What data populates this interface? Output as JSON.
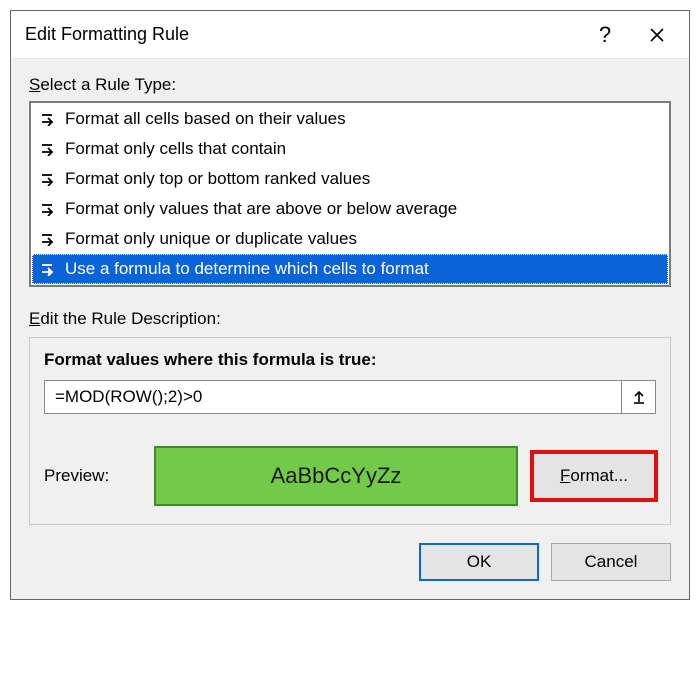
{
  "title": "Edit Formatting Rule",
  "sections": {
    "ruleType": {
      "label_pre": "S",
      "label_post": "elect a Rule Type:",
      "items": [
        "Format all cells based on their values",
        "Format only cells that contain",
        "Format only top or bottom ranked values",
        "Format only values that are above or below average",
        "Format only unique or duplicate values",
        "Use a formula to determine which cells to format"
      ],
      "selected_index": 5
    },
    "description": {
      "label_pre": "E",
      "label_post": "dit the Rule Description:",
      "formula_label": "Format values where this formula is true:",
      "formula_value": "=MOD(ROW();2)>0"
    },
    "preview": {
      "label": "Preview:",
      "sample": "AaBbCcYyZz",
      "format_btn_pre": "F",
      "format_btn_post": "ormat..."
    }
  },
  "footer": {
    "ok": "OK",
    "cancel": "Cancel"
  }
}
